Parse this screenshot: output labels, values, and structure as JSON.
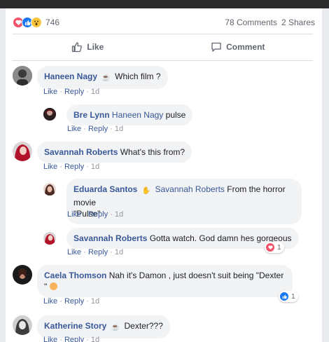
{
  "reactions": {
    "icons": [
      "love-icon",
      "like-icon",
      "wow-icon"
    ],
    "count": "746",
    "comments": "78 Comments",
    "shares": "2 Shares"
  },
  "actions": {
    "like": "Like",
    "comment": "Comment"
  },
  "meta_labels": {
    "like": "Like",
    "reply": "Reply",
    "sep": "·"
  },
  "comments": [
    {
      "name": "Haneen Nagy",
      "text": "Which film ?",
      "time": "1d"
    },
    {
      "name": "Bre Lynn",
      "mention": "Haneen Nagy",
      "text": "pulse",
      "time": "1d"
    },
    {
      "name": "Savannah Roberts",
      "text": "What's this from?",
      "time": "1d"
    },
    {
      "name": "Eduarda Santos",
      "mention": "Savannah Roberts",
      "text_line1": "From the horror movie",
      "text_line2": "\"Pulse\"",
      "time": "1d"
    },
    {
      "name": "Savannah Roberts",
      "text": "Gotta watch. God damn hes gorgeous",
      "time": "1d",
      "reaction_count": "1"
    },
    {
      "name": "Caela Thomson",
      "text_line1": "Nah it's Damon , just doesn't suit being \"Dexter",
      "text_line2": "\"",
      "time": "1d",
      "reaction_count": "1"
    },
    {
      "name": "Katherine Story",
      "text": "Dexter???",
      "time": "1d"
    }
  ],
  "colors": {
    "link": "#385898",
    "bubble": "#f2f3f5",
    "muted": "#606770",
    "like_blue": "#1877f2",
    "love_red": "#f25268"
  }
}
